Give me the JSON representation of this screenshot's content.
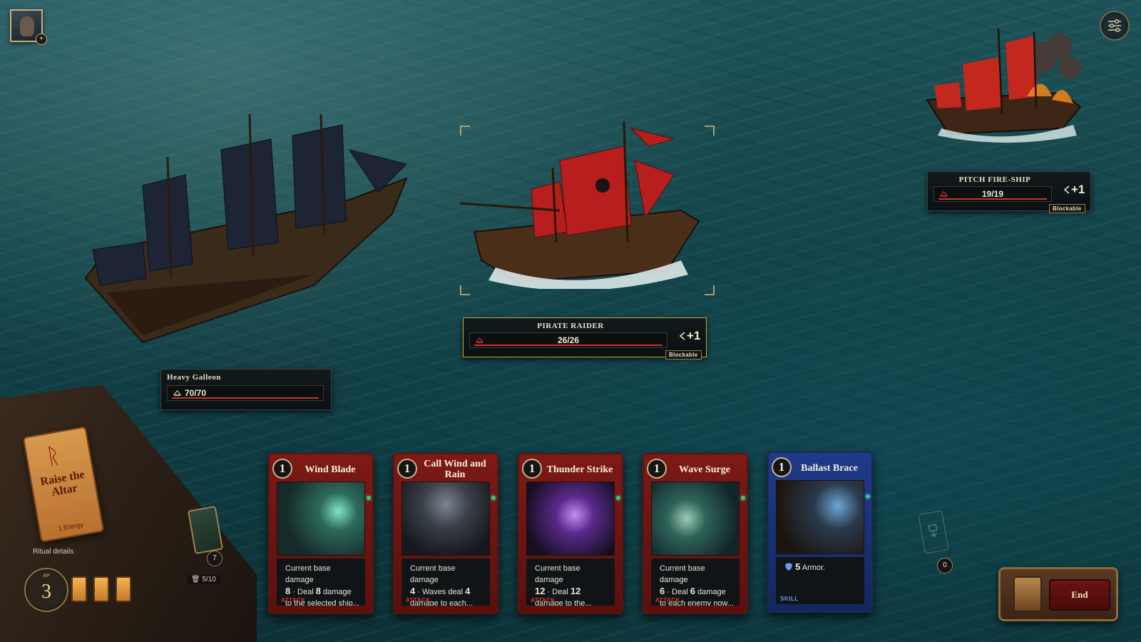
{
  "player": {
    "avatar_badge": "+"
  },
  "ships": {
    "player_ship": {
      "name": "Heavy Galleon",
      "hp": "70/70"
    },
    "enemies": [
      {
        "name": "PIRATE RAIDER",
        "hp": "26/26",
        "intent": "+1",
        "tag": "Blockable",
        "targeted": true
      },
      {
        "name": "PITCH FIRE-SHIP",
        "hp": "19/19",
        "intent": "+1",
        "tag": "Blockable",
        "targeted": false
      }
    ]
  },
  "hand": [
    {
      "cost": "1",
      "title": "Wind Blade",
      "line1_pre": "Current base damage",
      "num_a": "8",
      "mid": " · Deal ",
      "num_b": "8",
      "post": " damage",
      "line3": "to the selected ship...",
      "type": "ATTACK",
      "kind": "attack"
    },
    {
      "cost": "1",
      "title": "Call Wind and Rain",
      "line1_pre": "Current base damage",
      "num_a": "4",
      "mid": " · Waves deal ",
      "num_b": "4",
      "post": "",
      "line3": "damage to each...",
      "type": "ATTACK",
      "kind": "attack"
    },
    {
      "cost": "1",
      "title": "Thunder Strike",
      "line1_pre": "Current base damage",
      "num_a": "12",
      "mid": " · Deal ",
      "num_b": "12",
      "post": "",
      "line3": "damage to the...",
      "type": "ATTACK",
      "kind": "attack"
    },
    {
      "cost": "1",
      "title": "Wave Surge",
      "line1_pre": "Current base damage",
      "num_a": "6",
      "mid": " · Deal ",
      "num_b": "6",
      "post": " damage",
      "line3": "to each enemy now...",
      "type": "ATTACK",
      "kind": "attack"
    },
    {
      "cost": "1",
      "title": "Ballast Brace",
      "armor": "5",
      "armor_text": " Armor.",
      "type": "SKILL",
      "kind": "skill"
    }
  ],
  "ritual": {
    "scroll_title": "Raise the Altar",
    "scroll_cost": "1 Energy",
    "details_label": "Ritual details",
    "ap_label": "AP",
    "ap_value": "3",
    "energy_slots": 3
  },
  "deck": {
    "draw_count": "7",
    "discard": "5/10",
    "pile_count": "0"
  },
  "end_button": {
    "label": "End"
  },
  "colors": {
    "attack": "#7d1a15",
    "skill": "#1f3a8a",
    "hp_line": "#c8332b",
    "gold": "#c9b07a"
  },
  "icons": [
    "settings-icon",
    "helm-icon",
    "shield-icon",
    "intent-arrow-icon",
    "trash-icon"
  ]
}
